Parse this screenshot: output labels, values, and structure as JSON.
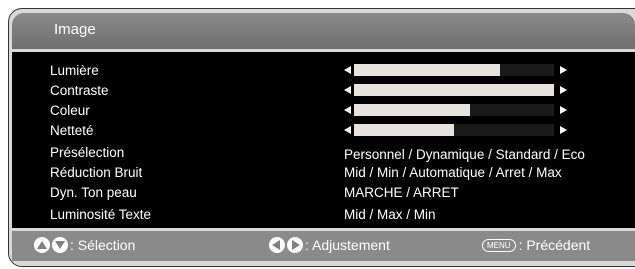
{
  "title": "Image",
  "items": [
    {
      "label": "Lumière",
      "fill": 0.73
    },
    {
      "label": "Contraste",
      "fill": 1.0
    },
    {
      "label": "Coleur",
      "fill": 0.58
    },
    {
      "label": "Netteté",
      "fill": 0.5
    },
    {
      "label": "Présélection",
      "value": "Personnel / Dynamique / Standard / Eco"
    },
    {
      "label": "Réduction Bruit",
      "value": "Mid / Min /  Automatique / Arret / Max"
    },
    {
      "label": "Dyn. Ton peau",
      "value": "MARCHE / ARRET"
    },
    {
      "label": "Luminosité Texte",
      "value": "Mid / Max / Min"
    }
  ],
  "footer": {
    "select_label": ": Sélection",
    "adjust_label": ": Adjustement",
    "menu_key": "MENU",
    "back_label": ": Précédent"
  },
  "icons": [
    "up-arrow-icon",
    "down-arrow-icon",
    "left-arrow-icon",
    "right-arrow-icon",
    "menu-key-icon"
  ]
}
